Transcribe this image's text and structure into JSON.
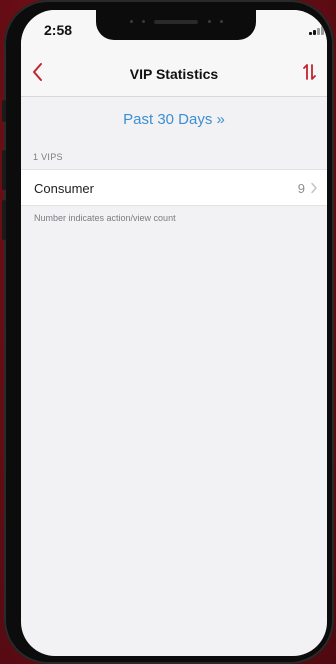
{
  "status_bar": {
    "time": "2:58",
    "icons": [
      "signal-icon",
      "wifi-icon",
      "battery-icon"
    ]
  },
  "nav": {
    "title": "VIP Statistics",
    "back_icon": "chevron-left-icon",
    "sort_icon": "sort-arrows-icon",
    "accent_color": "#c0242e"
  },
  "date_range": {
    "label": "Past 30 Days »",
    "color": "#3d8fd0"
  },
  "section": {
    "header": "1 VIPS"
  },
  "vip_list": [
    {
      "label": "Consumer",
      "count": "9"
    }
  ],
  "footnote": "Number indicates action/view count"
}
